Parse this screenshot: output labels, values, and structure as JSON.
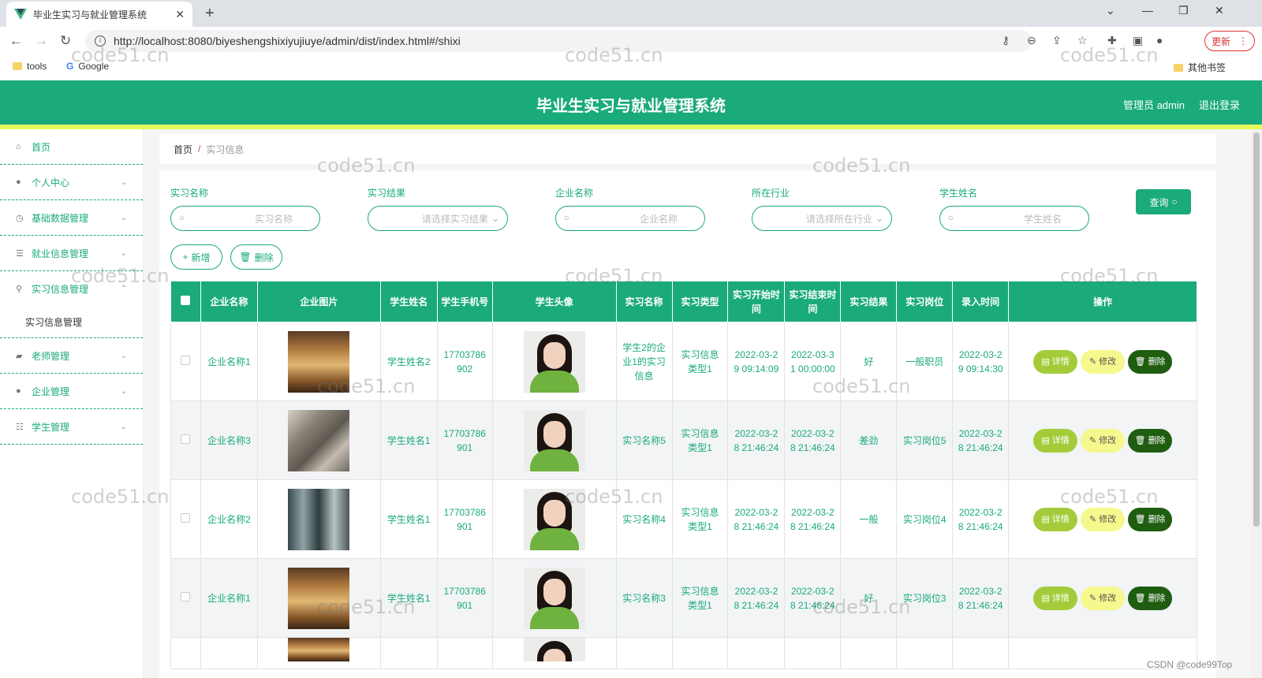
{
  "browser": {
    "tab_title": "毕业生实习与就业管理系统",
    "url": "http://localhost:8080/biyeshengshixiyujiuye/admin/dist/index.html#/shixi",
    "update_label": "更新",
    "bookmarks": [
      "tools",
      "Google"
    ],
    "other_bookmarks": "其他书签"
  },
  "header": {
    "title": "毕业生实习与就业管理系统",
    "user": "管理员 admin",
    "logout": "退出登录"
  },
  "sidebar": {
    "items": [
      {
        "label": "首页",
        "icon": "home-icon"
      },
      {
        "label": "个人中心",
        "icon": "user-icon"
      },
      {
        "label": "基础数据管理",
        "icon": "clock-icon"
      },
      {
        "label": "就业信息管理",
        "icon": "list-icon"
      },
      {
        "label": "实习信息管理",
        "icon": "mic-icon"
      },
      {
        "label": "老师管理",
        "icon": "camera-icon"
      },
      {
        "label": "企业管理",
        "icon": "pin-icon"
      },
      {
        "label": "学生管理",
        "icon": "sliders-icon"
      }
    ],
    "sub_item": "实习信息管理"
  },
  "breadcrumb": {
    "home": "首页",
    "sep": "/",
    "current": "实习信息"
  },
  "search": {
    "fields": [
      {
        "label": "实习名称",
        "placeholder": "实习名称"
      },
      {
        "label": "实习结果",
        "placeholder": "请选择实习结果"
      },
      {
        "label": "企业名称",
        "placeholder": "企业名称"
      },
      {
        "label": "所在行业",
        "placeholder": "请选择所在行业"
      },
      {
        "label": "学生姓名",
        "placeholder": "学生姓名"
      }
    ],
    "query_label": "查询"
  },
  "actions": {
    "add": "新增",
    "delete": "删除"
  },
  "table": {
    "headers": [
      "企业名称",
      "企业图片",
      "学生姓名",
      "学生手机号",
      "学生头像",
      "实习名称",
      "实习类型",
      "实习开始时间",
      "实习结束时间",
      "实习结果",
      "实习岗位",
      "录入时间",
      "操作"
    ],
    "rows": [
      {
        "company": "企业名称1",
        "img": "c1",
        "student": "学生姓名2",
        "phone": "17703786902",
        "name": "学生2的企业1的实习信息",
        "type": "实习信息类型1",
        "start": "2022-03-29 09:14:09",
        "end": "2022-03-31 00:00:00",
        "result": "好",
        "post": "一般职员",
        "created": "2022-03-29 09:14:30"
      },
      {
        "company": "企业名称3",
        "img": "c2",
        "student": "学生姓名1",
        "phone": "17703786901",
        "name": "实习名称5",
        "type": "实习信息类型1",
        "start": "2022-03-28 21:46:24",
        "end": "2022-03-28 21:46:24",
        "result": "差劲",
        "post": "实习岗位5",
        "created": "2022-03-28 21:46:24"
      },
      {
        "company": "企业名称2",
        "img": "c3",
        "student": "学生姓名1",
        "phone": "17703786901",
        "name": "实习名称4",
        "type": "实习信息类型1",
        "start": "2022-03-28 21:46:24",
        "end": "2022-03-28 21:46:24",
        "result": "一般",
        "post": "实习岗位4",
        "created": "2022-03-28 21:46:24"
      },
      {
        "company": "企业名称1",
        "img": "c1",
        "student": "学生姓名1",
        "phone": "17703786901",
        "name": "实习名称3",
        "type": "实习信息类型1",
        "start": "2022-03-28 21:46:24",
        "end": "2022-03-28 21:46:24",
        "result": "好",
        "post": "实习岗位3",
        "created": "2022-03-28 21:46:24"
      }
    ],
    "op_labels": {
      "detail": "详情",
      "edit": "修改",
      "del": "删除"
    }
  },
  "watermark": "code51.cn",
  "credit": "CSDN @code99Top"
}
